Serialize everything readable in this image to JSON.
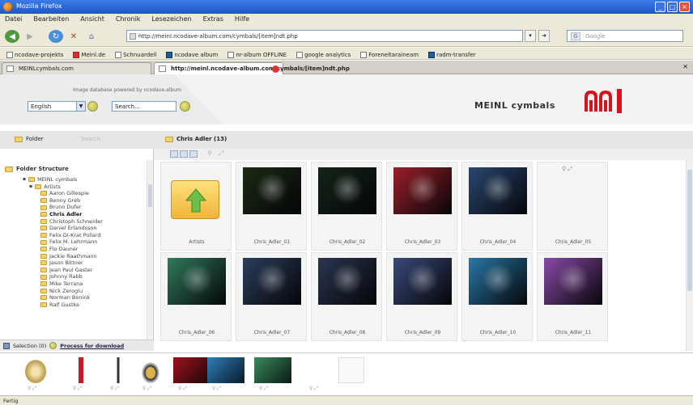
{
  "window": {
    "title": "Mozilla Firefox",
    "controls": [
      "_",
      "□",
      "×"
    ]
  },
  "menu": [
    "Datei",
    "Bearbeiten",
    "Ansicht",
    "Chronik",
    "Lesezeichen",
    "Extras",
    "Hilfe"
  ],
  "nav": {
    "url": "http://meinl.ncodave-album.com/cymbals/[item]ndt.php",
    "search_placeholder": "Google"
  },
  "bookmarks": [
    "ncodave-projekts",
    "Meinl.de",
    "Schnuardell",
    "ncodave album",
    "nr-album OFFLINE",
    "google analytics",
    "Foreneltaraineam",
    "radm-transfer"
  ],
  "tabs": [
    {
      "label": "MEINLcymbals.com"
    },
    {
      "label": "http://meinl.ncodave-album.com/cymbals/[item]ndt.php"
    }
  ],
  "header": {
    "tagline": "Image database powered by ncodave-album",
    "language": "English",
    "search_value": "Search...",
    "brand": "MEINL cymbals"
  },
  "left_panel": {
    "tab_folder": "Folder",
    "tab_search": "Search",
    "structure_title": "Folder Structure",
    "root": "MEINL cymbals",
    "group": "Artists",
    "artists": [
      "Aaron Gillespie",
      "Benny Greb",
      "Bruno Dufer",
      "Chris Adler",
      "Christoph Schneider",
      "Daniel Erlandsson",
      "Felix Di-Krat Pollard",
      "Felix M. Lehrmann",
      "Flo Dauner",
      "Jackie Raathmann",
      "Jason Bittner",
      "Jean Paul Gaster",
      "Johnny Rabb",
      "Mike Terrana",
      "Nick Zeroglu",
      "Norman Bonink",
      "Ralf Gustke"
    ],
    "selected": "Chris Adler",
    "footer_count": "Selection (0)",
    "footer_link": "Process for download"
  },
  "content": {
    "folder_title": "Chris Adler (13)",
    "items": [
      {
        "caption": "Artists",
        "type": "up-folder"
      },
      {
        "caption": "Chris_Adler_01",
        "type": "photo",
        "tone": "#1a2a14"
      },
      {
        "caption": "Chris_Adler_02",
        "type": "photo",
        "tone": "#132418"
      },
      {
        "caption": "Chris_Adler_03",
        "type": "photo",
        "tone": "#9b1f2a"
      },
      {
        "caption": "Chris_Adler_04",
        "type": "photo",
        "tone": "#2a4770"
      },
      {
        "caption": "Chris_Adler_05",
        "type": "empty"
      },
      {
        "caption": "Chris_Adler_06",
        "type": "photo",
        "tone": "#2f7a5c"
      },
      {
        "caption": "Chris_Adler_07",
        "type": "photo",
        "tone": "#2c3e5c"
      },
      {
        "caption": "Chris_Adler_08",
        "type": "photo",
        "tone": "#2a3550"
      },
      {
        "caption": "Chris_Adler_09",
        "type": "photo",
        "tone": "#3a4a7a"
      },
      {
        "caption": "Chris_Adler_10",
        "type": "photo",
        "tone": "#2a78a8"
      },
      {
        "caption": "Chris_Adler_11",
        "type": "photo",
        "tone": "#8a4aa8"
      }
    ]
  },
  "selection_strip": [
    {
      "kind": "cymbal"
    },
    {
      "kind": "bottle"
    },
    {
      "kind": "stand"
    },
    {
      "kind": "hat"
    },
    {
      "kind": "red-photo"
    },
    {
      "kind": "blue-photo"
    },
    {
      "kind": "green-photo"
    },
    {
      "kind": "empty"
    },
    {
      "kind": "blank"
    }
  ],
  "status": "Fertig"
}
